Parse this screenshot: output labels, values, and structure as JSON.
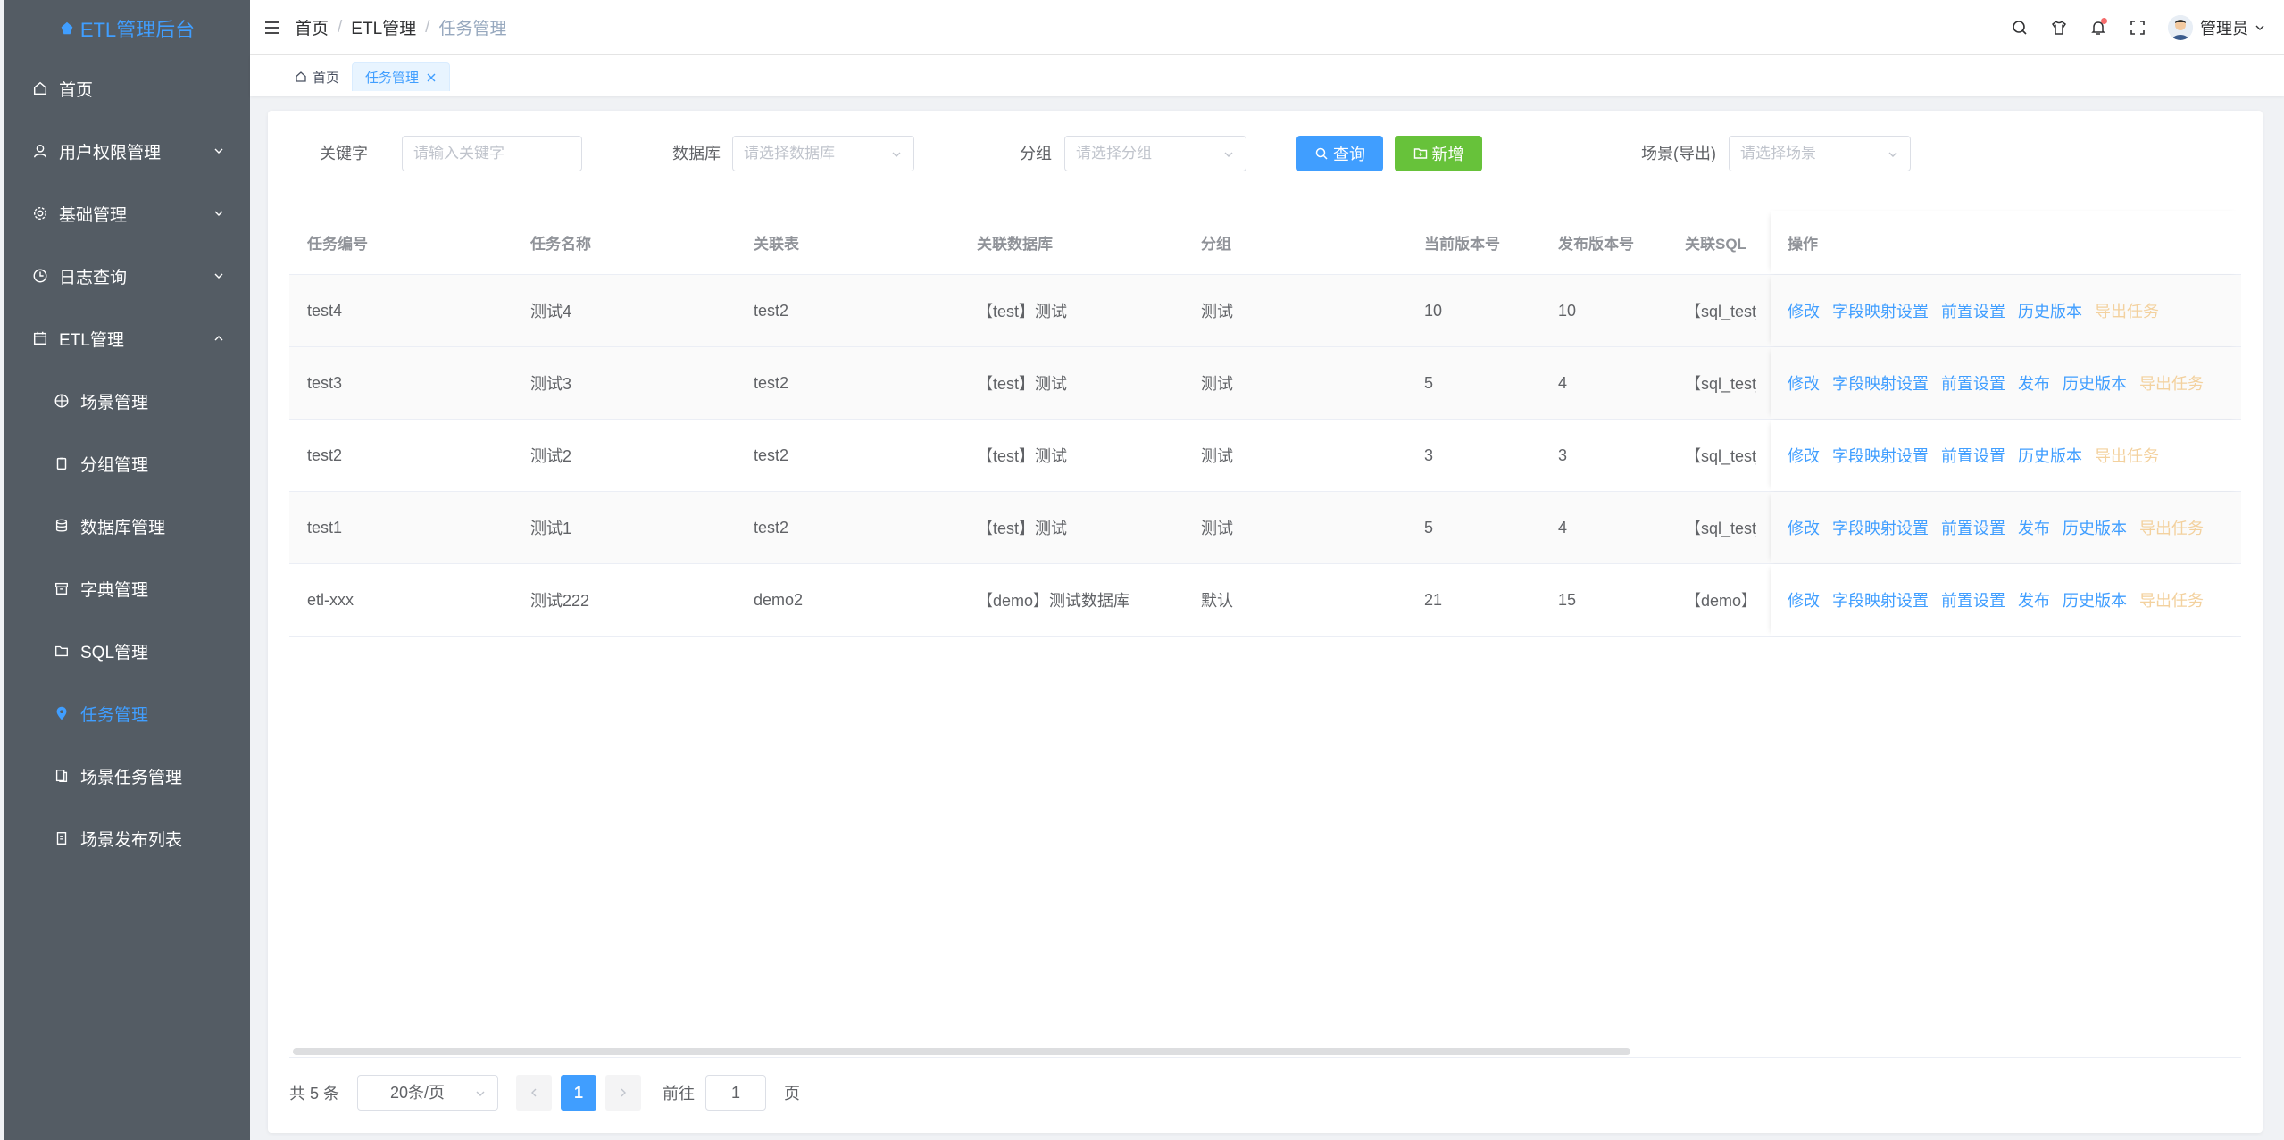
{
  "app": {
    "logo_text": "ETL管理后台"
  },
  "sidebar": {
    "items": [
      {
        "label": "首页"
      },
      {
        "label": "用户权限管理"
      },
      {
        "label": "基础管理"
      },
      {
        "label": "日志查询"
      },
      {
        "label": "ETL管理"
      }
    ],
    "sub_items": [
      {
        "label": "场景管理"
      },
      {
        "label": "分组管理"
      },
      {
        "label": "数据库管理"
      },
      {
        "label": "字典管理"
      },
      {
        "label": "SQL管理"
      },
      {
        "label": "任务管理"
      },
      {
        "label": "场景任务管理"
      },
      {
        "label": "场景发布列表"
      }
    ]
  },
  "header": {
    "breadcrumb": [
      "首页",
      "ETL管理",
      "任务管理"
    ],
    "separator": "/",
    "user_name": "管理员"
  },
  "tags": {
    "home": "首页",
    "active": "任务管理"
  },
  "filters": {
    "keyword_label": "关键字",
    "keyword_placeholder": "请输入关键字",
    "db_label": "数据库",
    "db_placeholder": "请选择数据库",
    "group_label": "分组",
    "group_placeholder": "请选择分组",
    "query_button": "查询",
    "add_button": "新增",
    "scene_label": "场景(导出)",
    "scene_placeholder": "请选择场景"
  },
  "table": {
    "columns": [
      "任务编号",
      "任务名称",
      "关联表",
      "关联数据库",
      "分组",
      "当前版本号",
      "发布版本号",
      "关联SQL",
      "操作"
    ],
    "rows": [
      {
        "id": "test4",
        "name": "测试4",
        "table": "test2",
        "db": "【test】测试",
        "group": "测试",
        "cur_ver": "10",
        "pub_ver": "10",
        "sql": "【sql_test_c",
        "ops": [
          "修改",
          "字段映射设置",
          "前置设置",
          "历史版本"
        ],
        "export": "导出任务"
      },
      {
        "id": "test3",
        "name": "测试3",
        "table": "test2",
        "db": "【test】测试",
        "group": "测试",
        "cur_ver": "5",
        "pub_ver": "4",
        "sql": "【sql_test_c",
        "ops": [
          "修改",
          "字段映射设置",
          "前置设置",
          "发布",
          "历史版本"
        ],
        "export": "导出任务"
      },
      {
        "id": "test2",
        "name": "测试2",
        "table": "test2",
        "db": "【test】测试",
        "group": "测试",
        "cur_ver": "3",
        "pub_ver": "3",
        "sql": "【sql_test_c",
        "ops": [
          "修改",
          "字段映射设置",
          "前置设置",
          "历史版本"
        ],
        "export": "导出任务"
      },
      {
        "id": "test1",
        "name": "测试1",
        "table": "test2",
        "db": "【test】测试",
        "group": "测试",
        "cur_ver": "5",
        "pub_ver": "4",
        "sql": "【sql_test_c",
        "ops": [
          "修改",
          "字段映射设置",
          "前置设置",
          "发布",
          "历史版本"
        ],
        "export": "导出任务"
      },
      {
        "id": "etl-xxx",
        "name": "测试222",
        "table": "demo2",
        "db": "【demo】测试数据库",
        "group": "默认",
        "cur_ver": "21",
        "pub_ver": "15",
        "sql": "【demo】测",
        "ops": [
          "修改",
          "字段映射设置",
          "前置设置",
          "发布",
          "历史版本"
        ],
        "export": "导出任务"
      }
    ]
  },
  "pagination": {
    "total": "共 5 条",
    "page_size": "20条/页",
    "current_page": "1",
    "goto_label": "前往",
    "goto_value": "1",
    "unit": "页"
  },
  "colors": {
    "primary": "#409eff",
    "success": "#67c23a",
    "sidebar_bg": "#545c64",
    "export_link": "#f3d19e"
  }
}
